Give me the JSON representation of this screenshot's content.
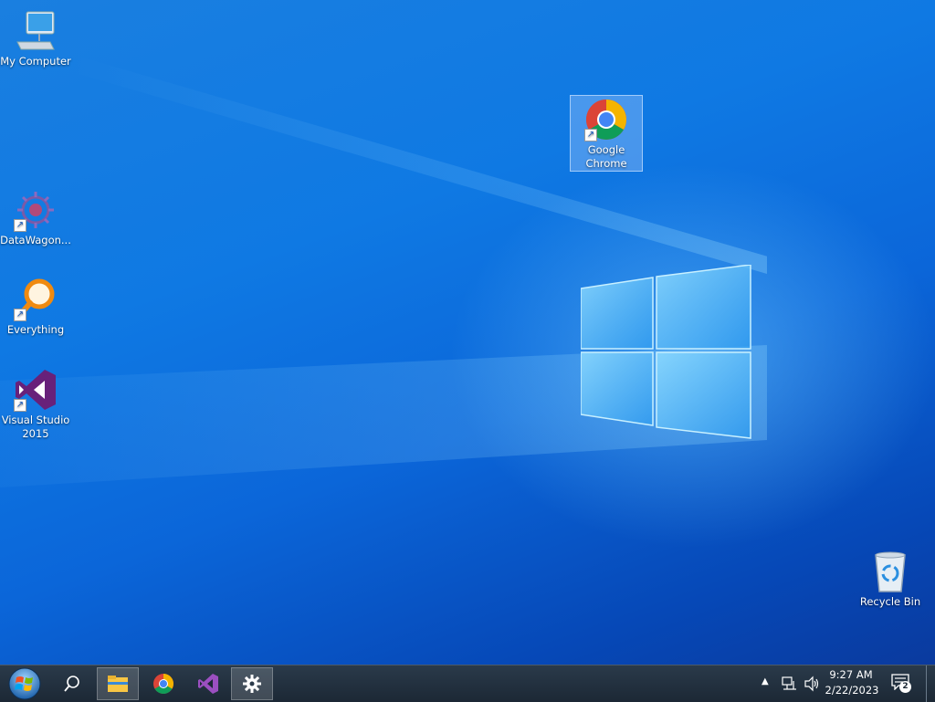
{
  "desktop": {
    "icons": [
      {
        "label": "My Computer"
      },
      {
        "label": "DataWagon..."
      },
      {
        "label": "Everything"
      },
      {
        "label": "Visual Studio 2015"
      },
      {
        "label": "Google Chrome"
      },
      {
        "label": "Recycle Bin"
      }
    ]
  },
  "taskbar": {
    "apps": [
      {
        "icon": "start-orb-icon"
      },
      {
        "icon": "search-icon"
      },
      {
        "icon": "file-explorer-icon"
      },
      {
        "icon": "chrome-icon"
      },
      {
        "icon": "visual-studio-icon"
      },
      {
        "icon": "settings-gear-icon"
      }
    ],
    "tray": {
      "time": "9:27 AM",
      "date": "2/22/2023",
      "notification_count": "2"
    }
  },
  "colors": {
    "desktop_blue": "#0f79e3",
    "taskbar": "#1c2835",
    "vs_purple": "#68217a"
  }
}
